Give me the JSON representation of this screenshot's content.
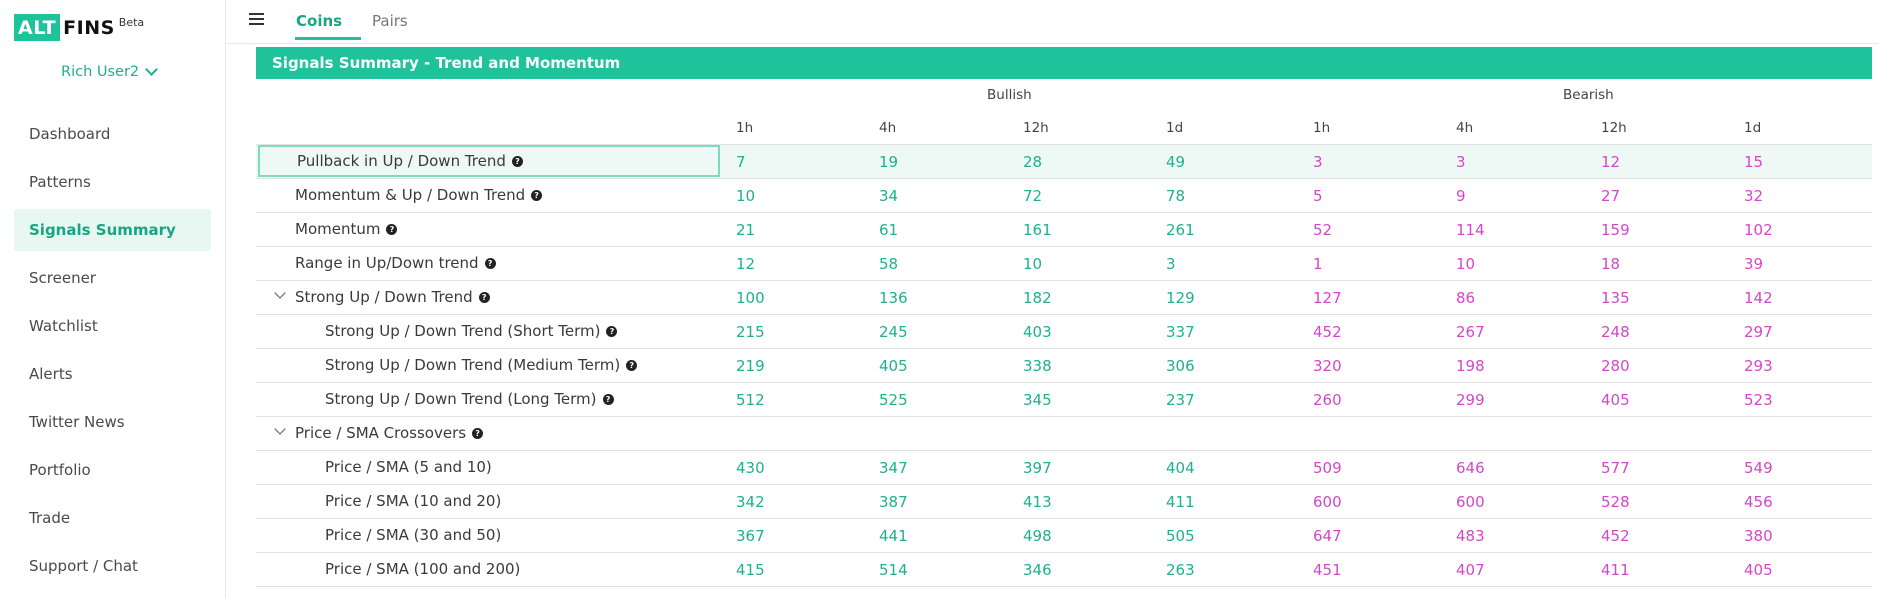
{
  "brand": {
    "logo_left": "ALT",
    "logo_right": "FINS",
    "beta": "Beta",
    "accent": "#1fc29a"
  },
  "user": {
    "name": "Rich User2"
  },
  "sidebar": {
    "items": [
      {
        "label": "Dashboard",
        "name": "sidebar-item-dashboard"
      },
      {
        "label": "Patterns",
        "name": "sidebar-item-patterns"
      },
      {
        "label": "Signals Summary",
        "name": "sidebar-item-signals-summary",
        "active": true
      },
      {
        "label": "Screener",
        "name": "sidebar-item-screener"
      },
      {
        "label": "Watchlist",
        "name": "sidebar-item-watchlist"
      },
      {
        "label": "Alerts",
        "name": "sidebar-item-alerts"
      },
      {
        "label": "Twitter News",
        "name": "sidebar-item-twitter-news"
      },
      {
        "label": "Portfolio",
        "name": "sidebar-item-portfolio"
      },
      {
        "label": "Trade",
        "name": "sidebar-item-trade"
      },
      {
        "label": "Support / Chat",
        "name": "sidebar-item-support-chat"
      }
    ]
  },
  "tabs": {
    "coins": "Coins",
    "pairs": "Pairs"
  },
  "panel": {
    "title": "Signals Summary - Trend and Momentum",
    "groups": {
      "bullish": "Bullish",
      "bearish": "Bearish"
    },
    "periods": [
      "1h",
      "4h",
      "12h",
      "1d",
      "1h",
      "4h",
      "12h",
      "1d"
    ],
    "rows": [
      {
        "label": "Pullback in Up / Down Trend",
        "level": 0,
        "help": true,
        "highlight": true,
        "bull": [
          "7",
          "19",
          "28",
          "49"
        ],
        "bear": [
          "3",
          "3",
          "12",
          "15"
        ]
      },
      {
        "label": "Momentum & Up / Down Trend",
        "level": 0,
        "help": true,
        "bull": [
          "10",
          "34",
          "72",
          "78"
        ],
        "bear": [
          "5",
          "9",
          "27",
          "32"
        ]
      },
      {
        "label": "Momentum",
        "level": 0,
        "help": true,
        "bull": [
          "21",
          "61",
          "161",
          "261"
        ],
        "bear": [
          "52",
          "114",
          "159",
          "102"
        ]
      },
      {
        "label": "Range in Up/Down trend",
        "level": 0,
        "help": true,
        "bull": [
          "12",
          "58",
          "10",
          "3"
        ],
        "bear": [
          "1",
          "10",
          "18",
          "39"
        ]
      },
      {
        "label": "Strong Up / Down Trend",
        "level": 0,
        "help": true,
        "caret": true,
        "bull": [
          "100",
          "136",
          "182",
          "129"
        ],
        "bear": [
          "127",
          "86",
          "135",
          "142"
        ]
      },
      {
        "label": "Strong Up / Down Trend (Short Term)",
        "level": 1,
        "help": true,
        "bull": [
          "215",
          "245",
          "403",
          "337"
        ],
        "bear": [
          "452",
          "267",
          "248",
          "297"
        ]
      },
      {
        "label": "Strong Up / Down Trend (Medium Term)",
        "level": 1,
        "help": true,
        "bull": [
          "219",
          "405",
          "338",
          "306"
        ],
        "bear": [
          "320",
          "198",
          "280",
          "293"
        ]
      },
      {
        "label": "Strong Up / Down Trend (Long Term)",
        "level": 1,
        "help": true,
        "bull": [
          "512",
          "525",
          "345",
          "237"
        ],
        "bear": [
          "260",
          "299",
          "405",
          "523"
        ]
      },
      {
        "label": "Price / SMA Crossovers",
        "level": 0,
        "help": true,
        "caret": true,
        "bull": [],
        "bear": []
      },
      {
        "label": "Price / SMA (5 and 10)",
        "level": 1,
        "help": false,
        "bull": [
          "430",
          "347",
          "397",
          "404"
        ],
        "bear": [
          "509",
          "646",
          "577",
          "549"
        ]
      },
      {
        "label": "Price / SMA (10 and 20)",
        "level": 1,
        "help": false,
        "bull": [
          "342",
          "387",
          "413",
          "411"
        ],
        "bear": [
          "600",
          "600",
          "528",
          "456"
        ]
      },
      {
        "label": "Price / SMA (30 and 50)",
        "level": 1,
        "help": false,
        "bull": [
          "367",
          "441",
          "498",
          "505"
        ],
        "bear": [
          "647",
          "483",
          "452",
          "380"
        ]
      },
      {
        "label": "Price / SMA (100 and 200)",
        "level": 1,
        "help": false,
        "bull": [
          "415",
          "514",
          "346",
          "263"
        ],
        "bear": [
          "451",
          "407",
          "411",
          "405"
        ]
      }
    ]
  }
}
